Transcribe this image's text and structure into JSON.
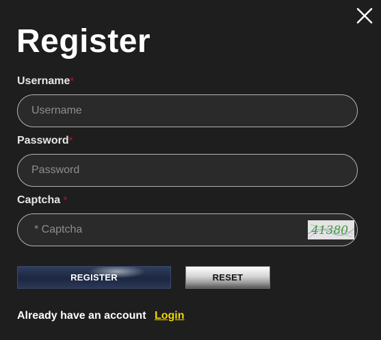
{
  "modal": {
    "title": "Register",
    "close_icon": "close-x-icon"
  },
  "form": {
    "username": {
      "label": "Username",
      "required_mark": "*",
      "placeholder": "Username",
      "value": ""
    },
    "password": {
      "label": "Password",
      "required_mark": "*",
      "placeholder": "Password",
      "value": ""
    },
    "captcha": {
      "label": "Captcha",
      "required_mark": "*",
      "placeholder": "* Captcha",
      "value": "",
      "image_text": "41380"
    }
  },
  "buttons": {
    "register": "REGISTER",
    "reset": "RESET"
  },
  "footer": {
    "text": "Already have an account",
    "login_link": "Login"
  },
  "colors": {
    "background": "#1e1e1e",
    "required": "#c4141c",
    "link": "#f2d600",
    "register_button": "#1c2740"
  }
}
